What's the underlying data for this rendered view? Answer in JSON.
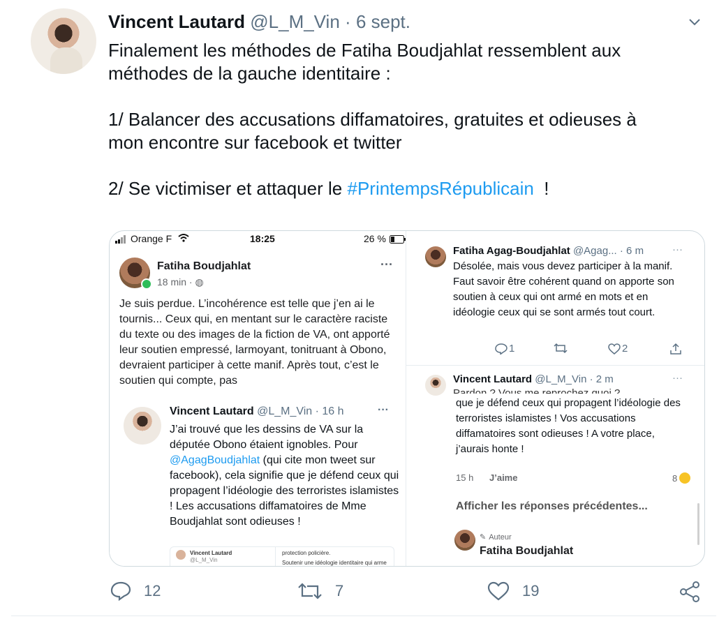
{
  "tweet": {
    "author_name": "Vincent Lautard",
    "author_handle": "@L_M_Vin",
    "separator": "·",
    "date": "6 sept.",
    "text_part1": "Finalement les méthodes de Fatiha Boudjahlat ressemblent aux\nméthodes de la gauche identitaire :\n\n1/ Balancer des accusations diffamatoires, gratuites et odieuses à\nmon encontre sur facebook et twitter\n\n2/ Se victimiser et attaquer le ",
    "hashtag": "#PrintempsRépublicain",
    "text_part2": "  !",
    "actions": {
      "reply_count": "12",
      "retweet_count": "7",
      "like_count": "19"
    }
  },
  "left_pane": {
    "status_bar": {
      "carrier": "Orange F",
      "time": "18:25",
      "battery": "26 %"
    },
    "fb_post": {
      "author": "Fatiha Boudjahlat",
      "meta": "18 min · ",
      "more": "···",
      "text": "Je suis perdue. L’incohérence est telle que j’en ai le tournis...\nCeux qui, en mentant sur le caractère raciste du texte ou des images de la fiction de VA, ont apporté leur soutien empressé, larmoyant, tonitruant à Obono, devraient participer à cette manif. Après tout, c’est le soutien qui compte, pas"
    },
    "quoted_tweet": {
      "author_name": "Vincent Lautard",
      "author_handle": "@L_M_Vin · 16 h",
      "more": "···",
      "text_before": "J’ai trouvé que les dessins de VA sur la députée Obono étaient ignobles. Pour ",
      "mention": "@AgagBoudjahlat",
      "text_after": " (qui cite mon tweet sur facebook), cela signifie que je défend ceux qui propagent l’idéologie des terroristes islamistes ! Les accusations diffamatoires de Mme Boudjahlat sont odieuses !",
      "mini_name": "Vincent Lautard",
      "mini_handle": "@L_M_Vin",
      "mini_right_1": "protection policière.",
      "mini_right_2": "Soutenir une idéologie identitaire qui arme en"
    }
  },
  "right_pane": {
    "reply1": {
      "author_name": "Fatiha Agag-Boudjahlat",
      "author_handle": "@Agag...",
      "time": "· 6 m",
      "more": "···",
      "text": "Désolée, mais vous devez participer à la manif. Faut savoir être cohérent quand on apporte son soutien à ceux qui ont armé en mots et en idéologie ceux qui se sont armés tout court.",
      "reply_count": "1",
      "like_count": "2"
    },
    "reply2": {
      "author_name": "Vincent Lautard",
      "author_handle": "@L_M_Vin · 2 m",
      "more": "···",
      "overlap_text": "Pardon ? Vous me reprochez quoi ?",
      "text": "que je défend ceux qui propagent l’idéologie des terroristes islamistes ! Vos accusations diffamatoires sont odieuses ! A votre place, j’aurais honte !",
      "time": "15 h",
      "like_label": "J’aime",
      "reactions": "8"
    },
    "show_previous": "Afficher les réponses précédentes...",
    "author_badge": "Auteur",
    "author_name": "Fatiha Boudjahlat"
  }
}
